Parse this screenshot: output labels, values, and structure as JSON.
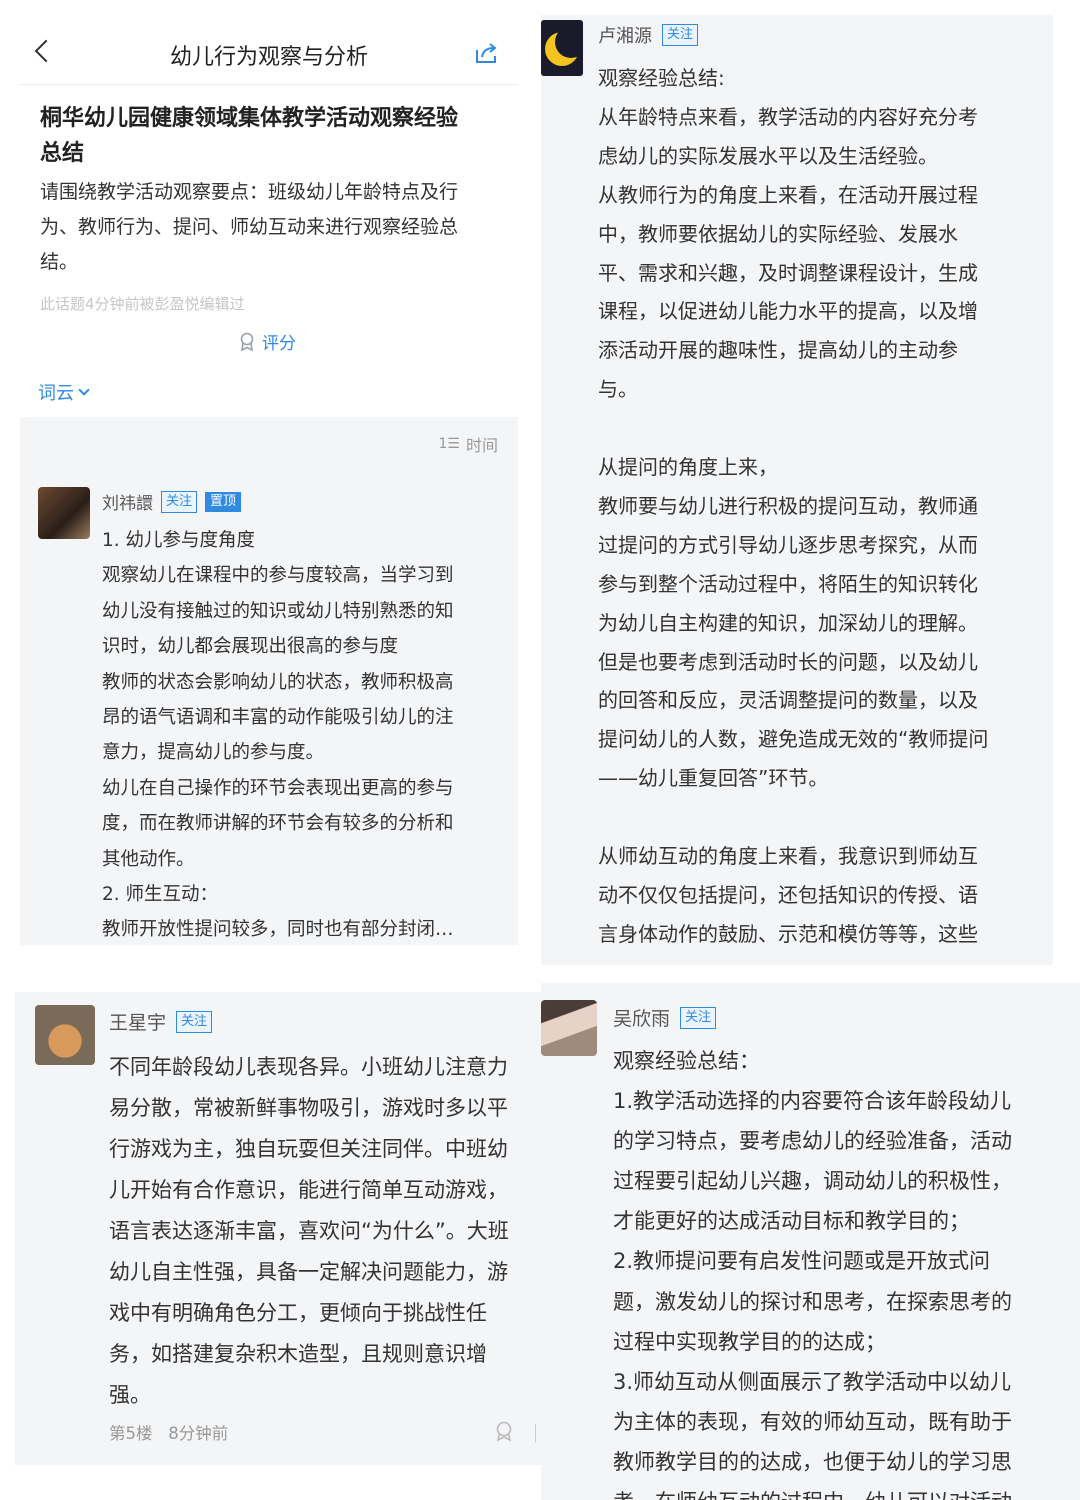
{
  "panel1": {
    "nav_title": "幼儿行为观察与分析",
    "topic_title_lines": [
      "桐华幼儿园健康领域集体教学活动观察经验",
      "总结"
    ],
    "topic_desc_lines": [
      "请围绕教学活动观察要点：班级幼儿年龄特点及行",
      "为、教师行为、提问、师幼互动来进行观察经验总",
      "结。"
    ],
    "edit_note": "此话题4分钟前被彭盈悦编辑过",
    "score_label": "评分",
    "word_cloud_label": "词云",
    "sort_label": "时间",
    "comment": {
      "author": "刘祎譞",
      "follow_tag": "关注",
      "top_tag": "置顶",
      "lines": [
        "1. 幼儿参与度角度",
        "观察幼儿在课程中的参与度较高，当学习到",
        "幼儿没有接触过的知识或幼儿特别熟悉的知",
        "识时，幼儿都会展现出很高的参与度",
        "教师的状态会影响幼儿的状态，教师积极高",
        "昂的语气语调和丰富的动作能吸引幼儿的注",
        "意力，提高幼儿的参与度。",
        "幼儿在自己操作的环节会表现出更高的参与",
        "度，而在教师讲解的环节会有较多的分析和",
        "其他动作。",
        "2. 师生互动：",
        "教师开放性提问较多，同时也有部分封闭…"
      ]
    }
  },
  "panel2": {
    "author": "卢湘源",
    "follow_tag": "关注",
    "lines": [
      "观察经验总结:",
      "从年龄特点来看，教学活动的内容好充分考",
      "虑幼儿的实际发展水平以及生活经验。",
      "从教师行为的角度上来看，在活动开展过程",
      "中，教师要依据幼儿的实际经验、发展水",
      "平、需求和兴趣，及时调整课程设计，生成",
      "课程，以促进幼儿能力水平的提高，以及增",
      "添活动开展的趣味性，提高幼儿的主动参",
      "与。",
      "",
      "从提问的角度上来，",
      "教师要与幼儿进行积极的提问互动，教师通",
      "过提问的方式引导幼儿逐步思考探究，从而",
      "参与到整个活动过程中，将陌生的知识转化",
      "为幼儿自主构建的知识，加深幼儿的理解。",
      "但是也要考虑到活动时长的问题，以及幼儿",
      "的回答和反应，灵活调整提问的数量，以及",
      "提问幼儿的人数，避免造成无效的“教师提问",
      "——幼儿重复回答”环节。",
      "",
      "从师幼互动的角度上来看，我意识到师幼互",
      "动不仅仅包括提问，还包括知识的传授、语",
      "言身体动作的鼓励、示范和模仿等等，这些"
    ]
  },
  "panel3": {
    "author": "王星宇",
    "follow_tag": "关注",
    "lines": [
      "不同年龄段幼儿表现各异。小班幼儿注意力",
      "易分散，常被新鲜事物吸引，游戏时多以平",
      "行游戏为主，独自玩耍但关注同伴。中班幼",
      "儿开始有合作意识，能进行简单互动游戏，",
      "语言表达逐渐丰富，喜欢问“为什么”。大班",
      "幼儿自主性强，具备一定解决问题能力，游",
      "戏中有明确角色分工，更倾向于挑战性任",
      "务，如搭建复杂积木造型，且规则意识增",
      "强。"
    ],
    "floor": "第5楼",
    "time": "8分钟前"
  },
  "panel4": {
    "author": "吴欣雨",
    "follow_tag": "关注",
    "lines": [
      "观察经验总结：",
      "1.教学活动选择的内容要符合该年龄段幼儿",
      "的学习特点，要考虑幼儿的经验准备，活动",
      "过程要引起幼儿兴趣，调动幼儿的积极性，",
      "才能更好的达成活动目标和教学目的；",
      "2.教师提问要有启发性问题或是开放式问",
      "题，激发幼儿的探讨和思考，在探索思考的",
      "过程中实现教学目的的达成；",
      "3.师幼互动从侧面展示了教学活动中以幼儿",
      "为主体的表现，有效的师幼互动，既有助于",
      "教师教学目的的达成，也便于幼儿的学习思",
      "考，在师幼互动的过程中，幼儿可以对活动"
    ]
  },
  "colors": {
    "accent": "#2f8ae0",
    "panel_bg": "#f4f5f7",
    "text": "#333333",
    "muted": "#999999"
  },
  "icons": [
    "back-arrow-icon",
    "share-icon",
    "award-icon",
    "chevron-down-icon",
    "sort-list-icon",
    "like-icon"
  ]
}
